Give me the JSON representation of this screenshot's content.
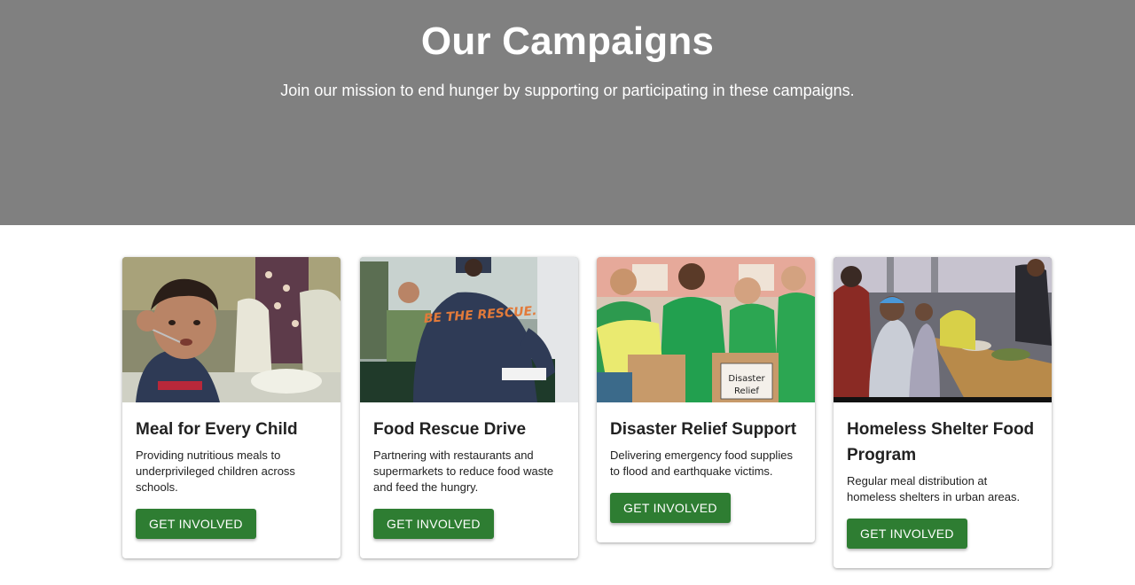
{
  "hero": {
    "title": "Our Campaigns",
    "subtitle": "Join our mission to end hunger by supporting or participating in these campaigns."
  },
  "campaigns": [
    {
      "title": "Meal for Every Child",
      "description": "Providing nutritious meals to underprivileged children across schools.",
      "button": "GET INVOLVED",
      "image": "child-eating-photo"
    },
    {
      "title": "Food Rescue Drive",
      "description": "Partnering with restaurants and supermarkets to reduce food waste and feed the hungry.",
      "button": "GET INVOLVED",
      "image": "volunteer-be-the-rescue-photo",
      "image_text": "BE THE RESCUE."
    },
    {
      "title": "Disaster Relief Support",
      "description": "Delivering emergency food supplies to flood and earthquake victims.",
      "button": "GET INVOLVED",
      "image": "volunteers-disaster-relief-box-photo",
      "image_text": "Disaster Relief"
    },
    {
      "title": "Homeless Shelter Food Program",
      "description": "Regular meal distribution at homeless shelters in urban areas.",
      "button": "GET INVOLVED",
      "image": "shelter-food-line-photo"
    }
  ],
  "colors": {
    "hero_bg": "#808080",
    "button_bg": "#2e7d32",
    "button_text": "#ffffff"
  }
}
